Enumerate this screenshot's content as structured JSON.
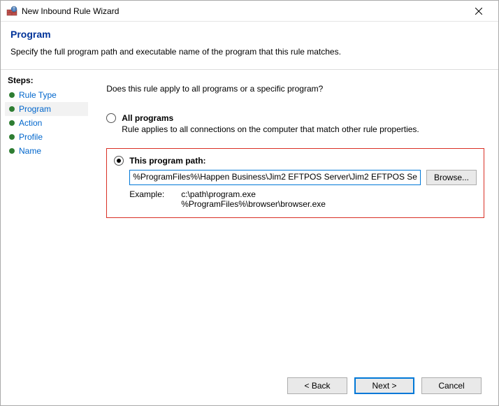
{
  "window": {
    "title": "New Inbound Rule Wizard"
  },
  "header": {
    "title": "Program",
    "subtitle": "Specify the full program path and executable name of the program that this rule matches."
  },
  "sidebar": {
    "steps_label": "Steps:",
    "items": [
      {
        "label": "Rule Type"
      },
      {
        "label": "Program"
      },
      {
        "label": "Action"
      },
      {
        "label": "Profile"
      },
      {
        "label": "Name"
      }
    ]
  },
  "main": {
    "question": "Does this rule apply to all programs or a specific program?",
    "all_programs": {
      "label": "All programs",
      "desc": "Rule applies to all connections on the computer that match other rule properties."
    },
    "this_program": {
      "label": "This program path:",
      "value": "%ProgramFiles%\\Happen Business\\Jim2 EFTPOS Server\\Jim2 EFTPOS Se",
      "browse": "Browse...",
      "example_label": "Example:",
      "example_lines": "c:\\path\\program.exe\n%ProgramFiles%\\browser\\browser.exe"
    }
  },
  "footer": {
    "back": "< Back",
    "next": "Next >",
    "cancel": "Cancel"
  }
}
